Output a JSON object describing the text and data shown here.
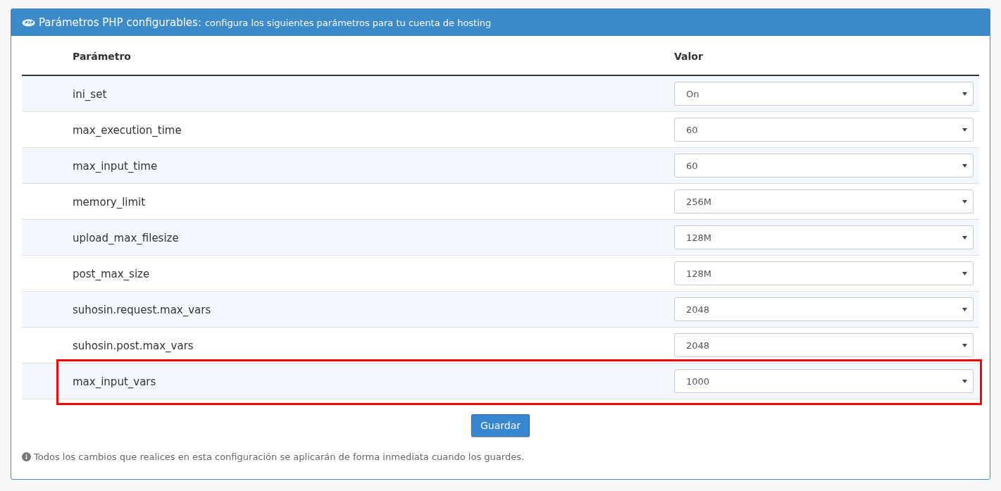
{
  "panel": {
    "title": "Parámetros PHP configurables:",
    "subtitle": "configura los siguientes parámetros para tu cuenta de hosting"
  },
  "table": {
    "columns": [
      "Parámetro",
      "Valor"
    ],
    "rows": [
      {
        "name": "ini_set",
        "value": "On",
        "highlighted": false
      },
      {
        "name": "max_execution_time",
        "value": "60",
        "highlighted": false
      },
      {
        "name": "max_input_time",
        "value": "60",
        "highlighted": false
      },
      {
        "name": "memory_limit",
        "value": "256M",
        "highlighted": false
      },
      {
        "name": "upload_max_filesize",
        "value": "128M",
        "highlighted": false
      },
      {
        "name": "post_max_size",
        "value": "128M",
        "highlighted": false
      },
      {
        "name": "suhosin.request.max_vars",
        "value": "2048",
        "highlighted": false
      },
      {
        "name": "suhosin.post.max_vars",
        "value": "2048",
        "highlighted": false
      },
      {
        "name": "max_input_vars",
        "value": "1000",
        "highlighted": true
      }
    ]
  },
  "save_button": "Guardar",
  "note": "Todos los cambios que realices en esta configuración se aplicarán de forma inmediata cuando los guardes."
}
